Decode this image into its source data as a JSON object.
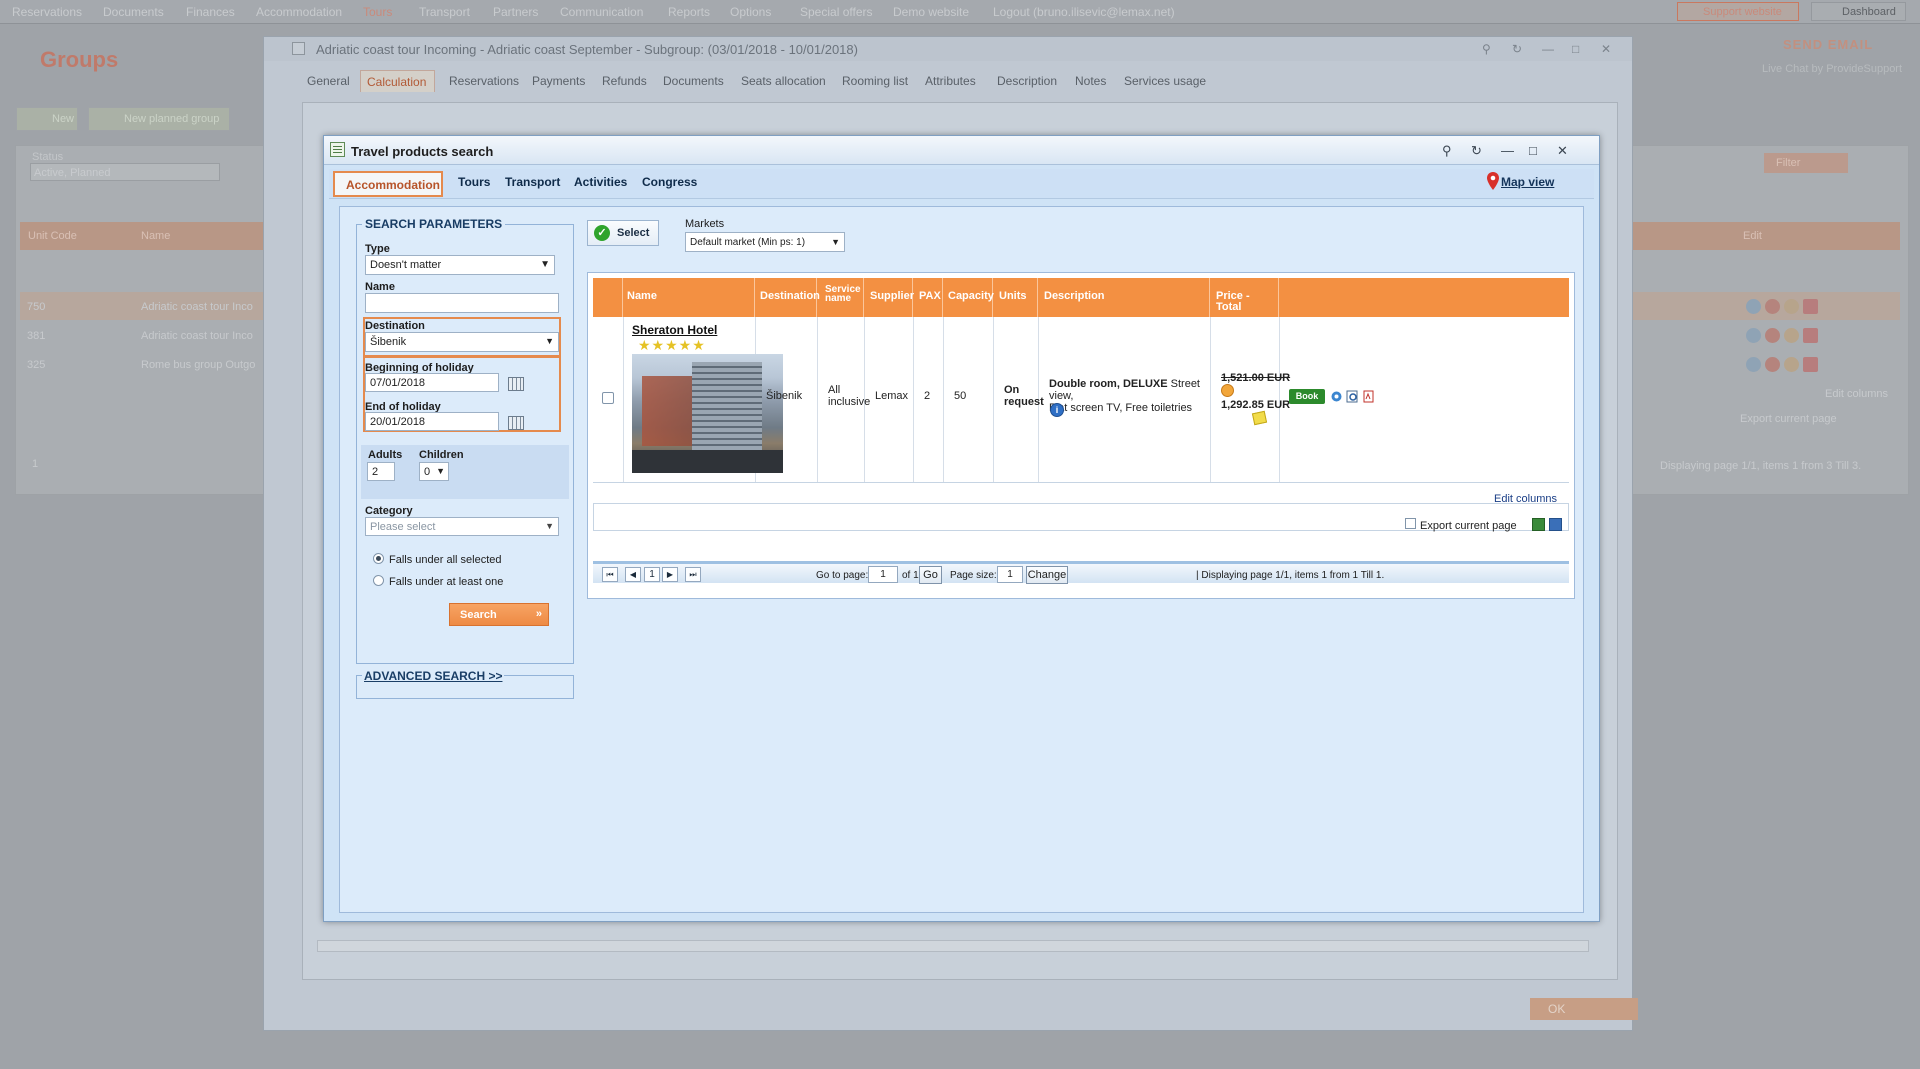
{
  "topmenu": {
    "items": [
      "Reservations",
      "Documents",
      "Finances",
      "Accommodation",
      "Tours",
      "Transport",
      "Partners",
      "Communication",
      "Reports",
      "Options",
      "Special offers",
      "Demo website",
      "Logout (bruno.ilisevic@lemax.net)"
    ],
    "support": "Support website",
    "dashboard": "Dashboard"
  },
  "background": {
    "title": "Groups",
    "send_email": "SEND EMAIL",
    "live_chat": "Live Chat by ProvideSupport",
    "new_btn": "New",
    "new_planned_btn": "New planned group",
    "status_label": "Status",
    "status_value": "Active, Planned",
    "filter_btn": "Filter",
    "col_unit_code": "Unit Code",
    "col_name": "Name",
    "col_edit": "Edit",
    "rows": [
      {
        "code": "750",
        "name": "Adriatic coast tour Inco"
      },
      {
        "code": "381",
        "name": "Adriatic coast tour Inco"
      },
      {
        "code": "325",
        "name": "Rome bus group Outgo"
      }
    ],
    "edit_columns": "Edit columns",
    "export": "Export current page",
    "pager_page": "1",
    "display": "Displaying page 1/1, items 1 from 3 Till 3."
  },
  "group_window": {
    "title": "Adriatic coast tour Incoming - Adriatic coast September - Subgroup: (03/01/2018 - 10/01/2018)",
    "tabs": [
      "General",
      "Calculation",
      "Reservations",
      "Payments",
      "Refunds",
      "Documents",
      "Seats allocation",
      "Rooming list",
      "Attributes",
      "Description",
      "Notes",
      "Services usage"
    ],
    "active_tab": "Calculation",
    "ok": "OK"
  },
  "dialog": {
    "title": "Travel products search",
    "tabs": [
      "Accommodation",
      "Tours",
      "Transport",
      "Activities",
      "Congress"
    ],
    "active_tab": "Accommodation",
    "map_view": "Map view",
    "search": {
      "legend": "SEARCH PARAMETERS",
      "type_label": "Type",
      "type_value": "Doesn't matter",
      "name_label": "Name",
      "name_value": "",
      "destination_label": "Destination",
      "destination_value": "Šibenik",
      "begin_label": "Beginning of holiday",
      "begin_value": "07/01/2018",
      "end_label": "End of holiday",
      "end_value": "20/01/2018",
      "adults_label": "Adults",
      "adults_value": "2",
      "children_label": "Children",
      "children_value": "0",
      "category_label": "Category",
      "category_placeholder": "Please select",
      "radio_all": "Falls under all selected",
      "radio_one": "Falls under at least one",
      "search_btn": "Search",
      "advanced": "ADVANCED SEARCH >>"
    },
    "select_btn": "Select",
    "markets_label": "Markets",
    "markets_value": "Default market (Min ps: 1)",
    "table": {
      "headers": [
        "Name",
        "Destination",
        "Service name",
        "Supplier",
        "PAX",
        "Capacity",
        "Units",
        "Description",
        "Price - Total"
      ],
      "row": {
        "hotel": "Sheraton Hotel",
        "stars": "★★★★★",
        "destination": "Šibenik",
        "service": "All inclusive",
        "supplier": "Lemax",
        "pax": "2",
        "capacity": "50",
        "units": "On request",
        "desc_bold1": "Double room,",
        "desc_bold2": "DELUXE",
        "desc_rest1": "Street view,",
        "desc_rest2": "Flat screen TV, Free toiletries",
        "old_price": "1,521.00 EUR",
        "new_price": "1,292.85 EUR",
        "book": "Book"
      },
      "edit_columns": "Edit columns",
      "export": "Export current page"
    },
    "pager": {
      "page_btn": "1",
      "goto_label": "Go to page:",
      "goto_value": "1",
      "of": "of 1",
      "go": "Go",
      "size_label": "Page size:",
      "size_value": "1",
      "change": "Change",
      "display": "| Displaying page  1/1,  items  1  from  1  Till  1."
    }
  },
  "colors": {
    "accent_orange": "#f39042",
    "dialog_bg": "#cfe3f6",
    "highlight": "#e58a4d",
    "book_green": "#2c8a2c"
  }
}
